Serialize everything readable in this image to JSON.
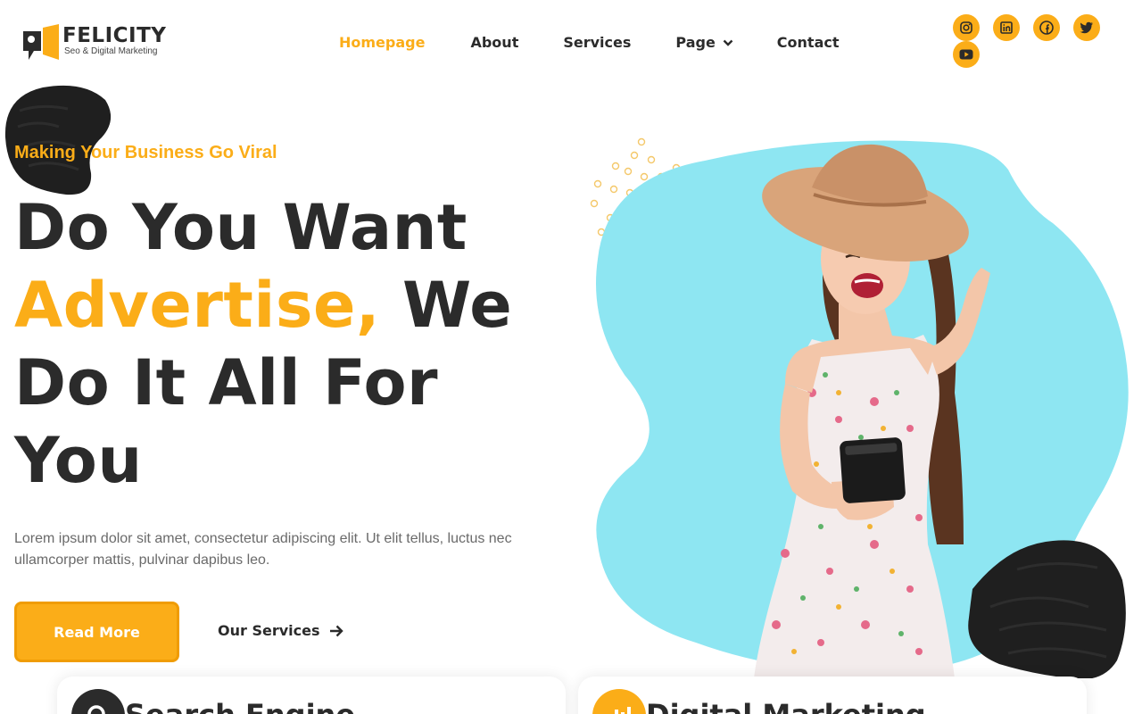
{
  "brand": {
    "name": "FELICITY",
    "tagline": "Seo & Digital Marketing",
    "accent_color": "#fbad18",
    "dark_color": "#2b2b2b",
    "sky_color": "#8ee6f2"
  },
  "nav": {
    "items": [
      {
        "label": "Homepage",
        "active": true
      },
      {
        "label": "About",
        "active": false
      },
      {
        "label": "Services",
        "active": false
      },
      {
        "label": "Page",
        "active": false,
        "has_dropdown": true
      },
      {
        "label": "Contact",
        "active": false
      }
    ]
  },
  "socials": [
    {
      "name": "instagram-icon"
    },
    {
      "name": "linkedin-icon"
    },
    {
      "name": "facebook-icon"
    },
    {
      "name": "twitter-icon"
    },
    {
      "name": "youtube-icon"
    }
  ],
  "hero": {
    "eyebrow": "Making Your Business Go Viral",
    "headline_part1": "Do You Want",
    "headline_highlight": "Advertise,",
    "headline_part2": "We Do It All For You",
    "lead": "Lorem ipsum dolor sit amet, consectetur adipiscing elit. Ut elit tellus, luctus nec ullamcorper mattis, pulvinar dapibus leo.",
    "primary_button": "Read More",
    "secondary_button": "Our Services"
  },
  "cards": [
    {
      "title": "Search Engine",
      "icon": "search-icon"
    },
    {
      "title": "Digital Marketing",
      "icon": "chart-bars-icon"
    }
  ]
}
